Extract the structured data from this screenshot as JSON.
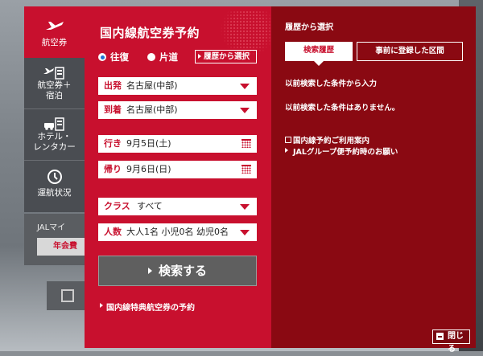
{
  "tabs": [
    {
      "label": "航空券",
      "icon": "airplane-icon",
      "active": true
    },
    {
      "label": "航空券＋\n宿泊",
      "icon": "airplane-hotel-icon",
      "active": false
    },
    {
      "label": "ホテル・\nレンタカー",
      "icon": "hotel-car-icon",
      "active": false
    },
    {
      "label": "運航状況",
      "icon": "clock-icon",
      "active": false
    }
  ],
  "form": {
    "title": "国内線航空券予約",
    "trip_round": "往復",
    "trip_oneway": "片道",
    "history_button": "履歴から選択",
    "departure": {
      "key": "出発",
      "value": "名古屋(中部)"
    },
    "arrival": {
      "key": "到着",
      "value": "名古屋(中部)"
    },
    "outbound": {
      "key": "行き",
      "value": "9月5日(土)"
    },
    "return": {
      "key": "帰り",
      "value": "9月6日(日)"
    },
    "class": {
      "key": "クラス",
      "value": "すべて"
    },
    "passengers": {
      "key": "人数",
      "value": "大人1名 小児0名 幼児0名"
    },
    "search_button": "検索する",
    "award_link": "国内線特典航空券の予約"
  },
  "history": {
    "title": "履歴から選択",
    "tab_recent": "検索履歴",
    "tab_registered": "事前に登録した区間",
    "text_input": "以前検索した条件から入力",
    "text_none": "以前検索した条件はありません。",
    "link_guide": "国内線予約ご利用案内",
    "link_group": "JALグループ便予約時のお願い",
    "close_button": "閉じる"
  },
  "background": {
    "mypage": "JALマイ",
    "annual": "年会費"
  },
  "colors": {
    "brand_red": "#c8102e",
    "dark_red": "#8a0912",
    "tab_gray": "#4a4d52"
  }
}
